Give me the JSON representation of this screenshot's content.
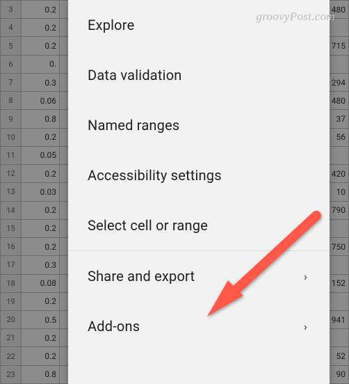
{
  "watermark": "groovyPost.com",
  "spreadsheet": {
    "rows": [
      {
        "num": "3",
        "valB": "0.2",
        "valRight": "480"
      },
      {
        "num": "4",
        "valB": "0.2",
        "valRight": ""
      },
      {
        "num": "5",
        "valB": "0.2",
        "valRight": "715"
      },
      {
        "num": "6",
        "valB": "0.",
        "valRight": ""
      },
      {
        "num": "7",
        "valB": "0.3",
        "valRight": "294"
      },
      {
        "num": "8",
        "valB": "0.06",
        "valRight": "480"
      },
      {
        "num": "9",
        "valB": "0.8",
        "valRight": "37"
      },
      {
        "num": "10",
        "valB": "0.2",
        "valRight": "56"
      },
      {
        "num": "11",
        "valB": "0.05",
        "valRight": ""
      },
      {
        "num": "12",
        "valB": "0.2",
        "valRight": "420"
      },
      {
        "num": "13",
        "valB": "0.03",
        "valRight": "10"
      },
      {
        "num": "14",
        "valB": "0.2",
        "valRight": "790"
      },
      {
        "num": "15",
        "valB": "0.2",
        "valRight": ""
      },
      {
        "num": "16",
        "valB": "0.2",
        "valRight": "750"
      },
      {
        "num": "17",
        "valB": "0.3",
        "valRight": ""
      },
      {
        "num": "18",
        "valB": "0.08",
        "valRight": "152"
      },
      {
        "num": "19",
        "valB": "0.2",
        "valRight": ""
      },
      {
        "num": "20",
        "valB": "0.5",
        "valRight": "941"
      },
      {
        "num": "21",
        "valB": "0.2",
        "valRight": ""
      },
      {
        "num": "22",
        "valB": "0.2",
        "valRight": "52"
      },
      {
        "num": "23",
        "valB": "0.8",
        "valRight": "90"
      }
    ]
  },
  "menu": {
    "items": [
      {
        "label": "Explore",
        "hasChevron": false
      },
      {
        "label": "Data validation",
        "hasChevron": false
      },
      {
        "label": "Named ranges",
        "hasChevron": false
      },
      {
        "label": "Accessibility settings",
        "hasChevron": false
      },
      {
        "label": "Select cell or range",
        "hasChevron": false
      },
      {
        "label": "Share and export",
        "hasChevron": true
      },
      {
        "label": "Add-ons",
        "hasChevron": true
      }
    ]
  },
  "chevron_glyph": "›"
}
